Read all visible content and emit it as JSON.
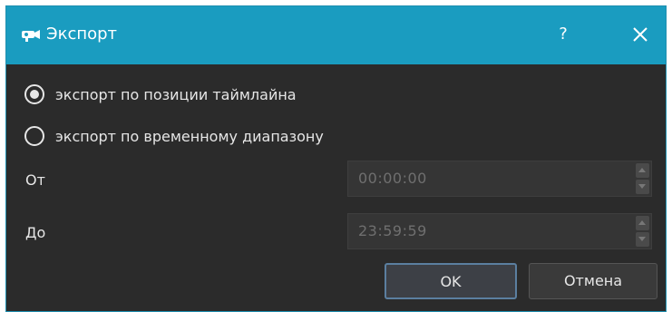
{
  "window": {
    "title": "Экспорт",
    "help_label": "?",
    "accent_color": "#1a9cc0"
  },
  "options": [
    {
      "label": "экспорт по позиции таймлайна",
      "checked": true
    },
    {
      "label": "экспорт по временному диапазону",
      "checked": false
    }
  ],
  "from": {
    "label": "От",
    "value": "00:00:00"
  },
  "to": {
    "label": "До",
    "value": "23:59:59"
  },
  "buttons": {
    "ok": "OK",
    "cancel": "Отмена"
  },
  "icons": {
    "app": "camera-icon",
    "close": "close-icon",
    "spin_up": "chevron-up-icon",
    "spin_down": "chevron-down-icon"
  }
}
